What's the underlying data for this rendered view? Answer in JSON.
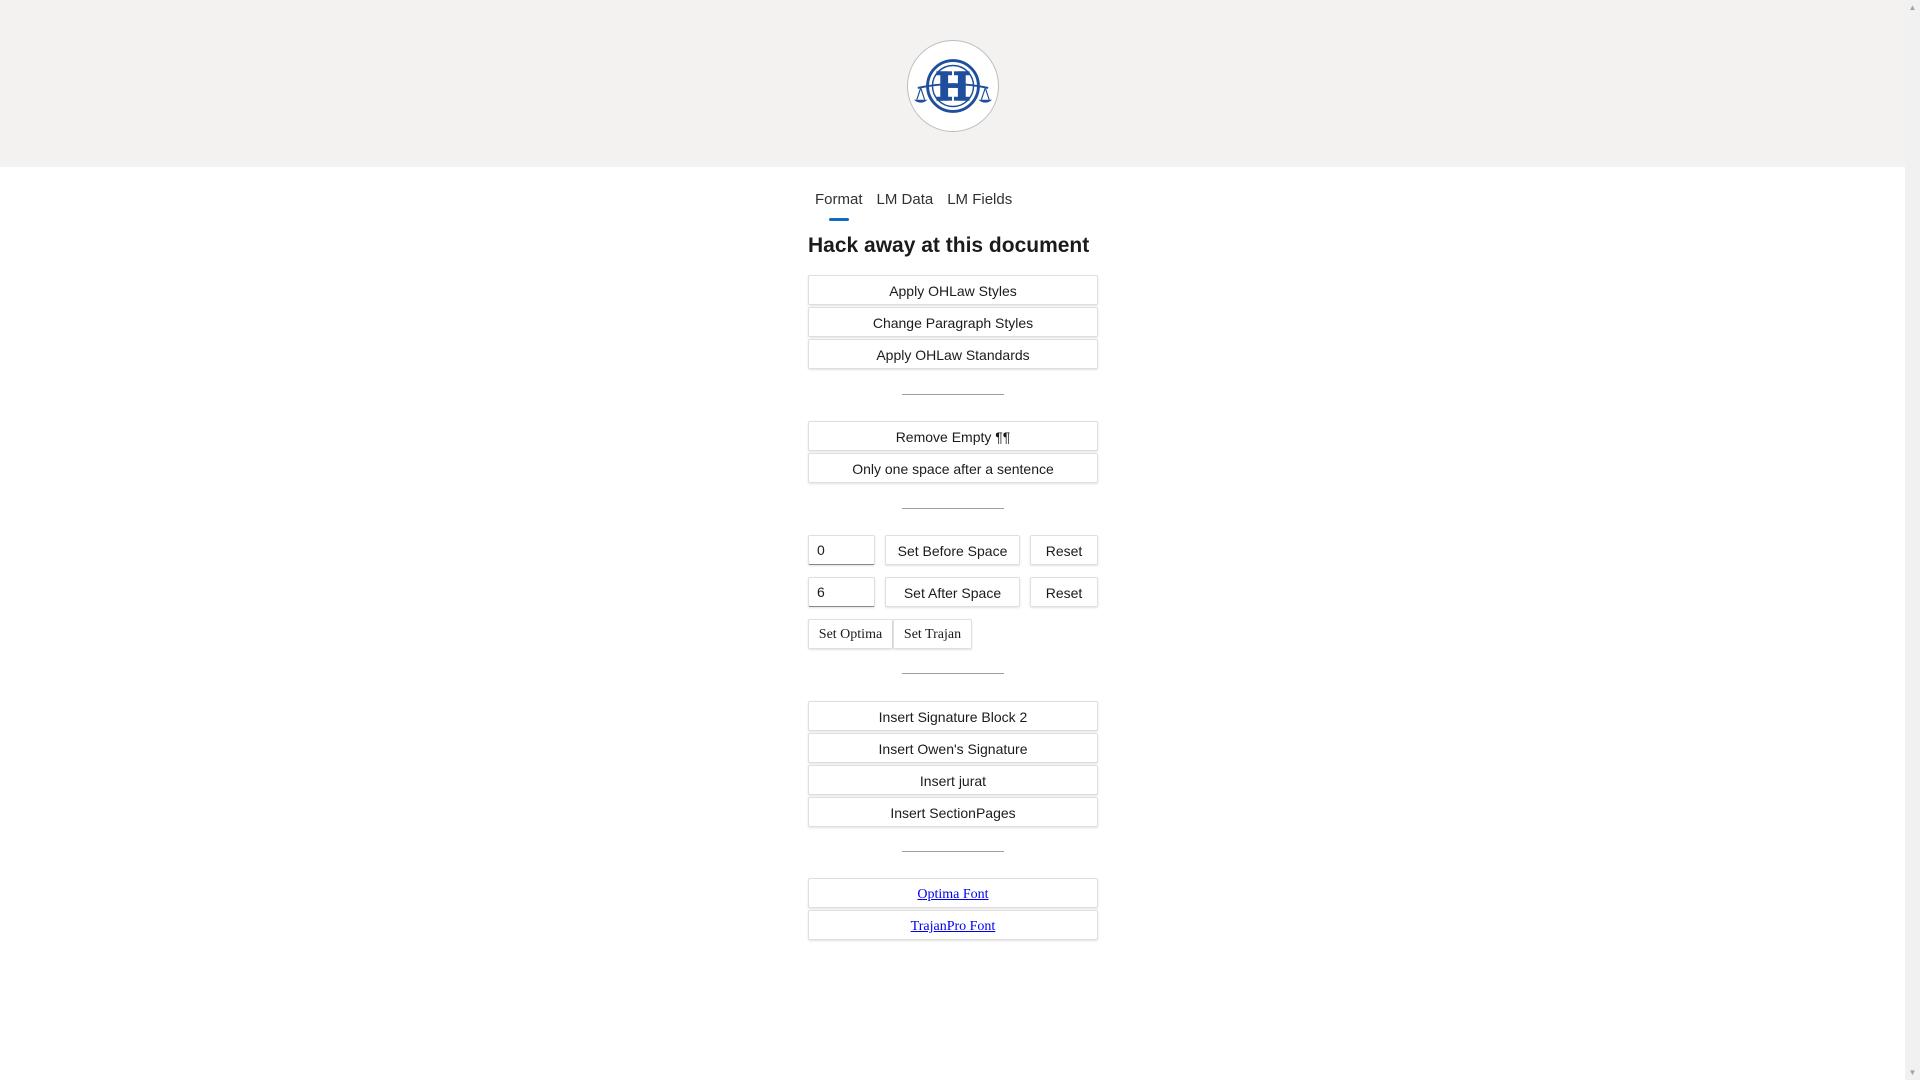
{
  "tabs": [
    {
      "label": "Format",
      "active": true
    },
    {
      "label": "LM Data",
      "active": false
    },
    {
      "label": "LM Fields",
      "active": false
    }
  ],
  "title": "Hack away at this document",
  "styles_section": {
    "apply_styles": "Apply OHLaw Styles",
    "change_paragraph_styles": "Change Paragraph Styles",
    "apply_standards": "Apply OHLaw Standards"
  },
  "cleanup_section": {
    "remove_empty": "Remove Empty ¶¶",
    "one_space": "Only one space after a sentence"
  },
  "spacing_section": {
    "before_value": "0",
    "set_before": "Set Before Space",
    "reset_before": "Reset",
    "after_value": "6",
    "set_after": "Set After Space",
    "reset_after": "Reset",
    "set_optima": "Set Optima",
    "set_trajan": "Set Trajan"
  },
  "insert_section": {
    "signature_block": "Insert Signature Block 2",
    "owens_signature": "Insert Owen's Signature",
    "jurat": "Insert jurat",
    "section_pages": "Insert SectionPages"
  },
  "links_section": {
    "optima_font": "Optima Font",
    "trajanpro_font": "TrajanPro Font"
  },
  "colors": {
    "header_bg": "#f3f2f1",
    "accent": "#0f6cbd",
    "logo_blue": "#1f4e9c",
    "link": "#0000ee"
  },
  "icons": {
    "logo": "law-scales-h-logo",
    "scroll_up": "chevron-up-icon",
    "scroll_down": "chevron-down-icon"
  }
}
